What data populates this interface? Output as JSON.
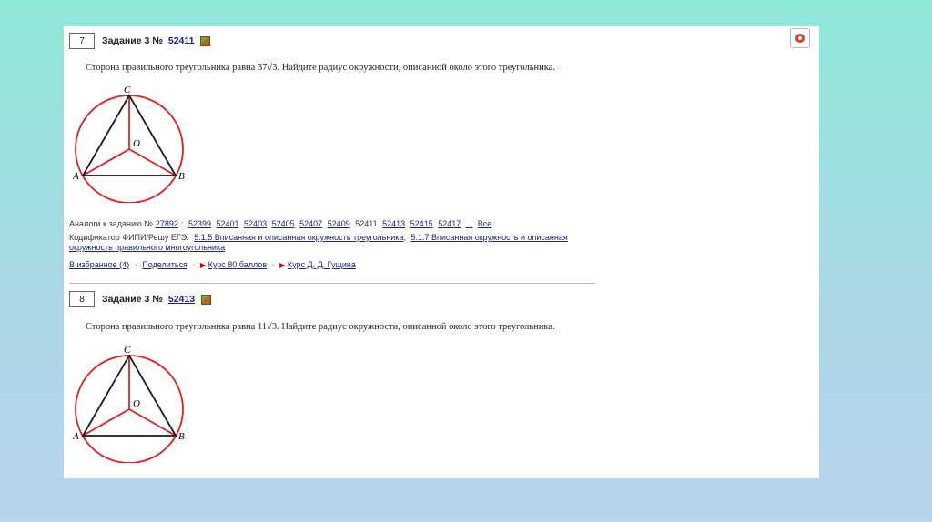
{
  "tasks": [
    {
      "number": "7",
      "title": "Задание 3 №",
      "id_link": "52411",
      "problem_before": "Сторона правильного треугольника равна",
      "problem_value": "37√3",
      "problem_after": ". Найдите радиус окружности, описанной около этого треугольника.",
      "labels": {
        "a": "A",
        "b": "B",
        "c": "C",
        "o": "O"
      }
    },
    {
      "number": "8",
      "title": "Задание 3 №",
      "id_link": "52413",
      "problem_before": "Сторона правильного треугольника равна",
      "problem_value": "11√3",
      "problem_after": ". Найдите радиус окружности, описанной около этого треугольника.",
      "labels": {
        "a": "A",
        "b": "B",
        "c": "C",
        "o": "O"
      }
    }
  ],
  "analogs": {
    "prefix": "Аналоги к заданию №",
    "base": "27892",
    "colon": ":",
    "items": [
      "52399",
      "52401",
      "52403",
      "52405",
      "52407",
      "52409"
    ],
    "current": "52411",
    "items2": [
      "52413",
      "52415",
      "52417"
    ],
    "more": "...",
    "all": "Все"
  },
  "codifier": {
    "prefix": "Кодификатор ФИПИ/Решу ЕГЭ:",
    "link1": "5.1.5 Вписанная и описанная окружность треугольника",
    "comma": ",",
    "link2a": "5.1.7 Вписанная окружность и описанная",
    "link2b": "окружность правильного многоугольника"
  },
  "actions": {
    "favorites": "В избранное (4)",
    "share": "Поделиться",
    "sep": "·",
    "course1": "Курс 80 баллов",
    "course2": "Курс Д. Д. Гущина"
  },
  "icons": {
    "help": "lifebuoy-icon",
    "cube": "cube-icon",
    "play": "triangle-play-icon"
  },
  "colors": {
    "link": "#1a237e",
    "circle": "#e02020",
    "accent_red": "#d00000"
  }
}
